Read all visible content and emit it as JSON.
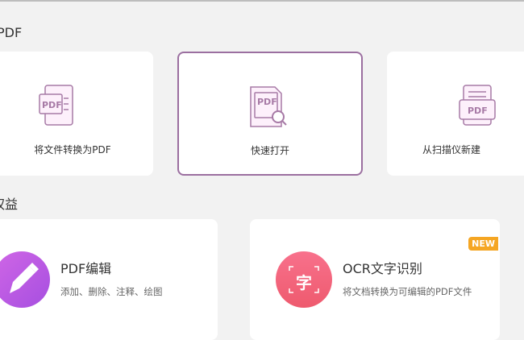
{
  "section1": {
    "title": "PDF"
  },
  "tools": [
    {
      "label": "将文件转换为PDF",
      "icon": "convert-pdf-icon"
    },
    {
      "label": "快速打开",
      "icon": "quick-open-pdf-icon",
      "selected": true
    },
    {
      "label": "从扫描仪新建",
      "icon": "scanner-pdf-icon"
    }
  ],
  "section2": {
    "title": "权益"
  },
  "features": [
    {
      "title": "PDF编辑",
      "desc": "添加、删除、注释、绘图",
      "icon": "pencil-icon",
      "color": "#b85be0"
    },
    {
      "title": "OCR文字识别",
      "desc": "将文档转换为可编辑的PDF文件",
      "icon": "ocr-char-icon",
      "icon_text": "字",
      "color": "#f0607a",
      "badge": "NEW"
    }
  ],
  "colors": {
    "accent": "#9b6fa0",
    "badge": "#f5a623"
  }
}
